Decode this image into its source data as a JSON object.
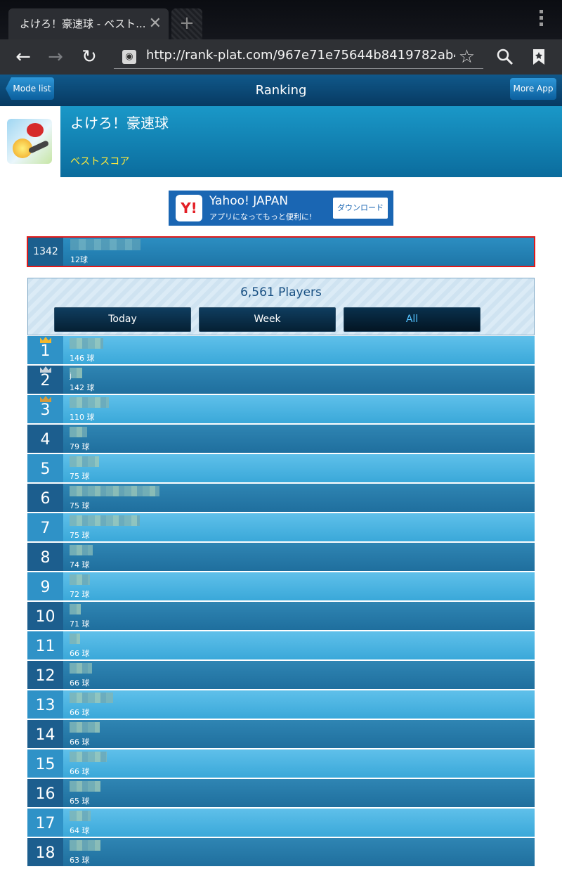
{
  "browser": {
    "tab_title": "よけろ！豪速球 - ベスト...",
    "tab_close": "✕",
    "new_tab": "+",
    "url": "http://rank-plat.com/967e71e75644b8419782ab4b36",
    "icons": [
      "back-icon",
      "forward-icon",
      "reload-icon",
      "globe-icon",
      "star-icon",
      "search-icon",
      "bookmarks-icon",
      "menu-icon"
    ]
  },
  "appbar": {
    "mode_list": "Mode list",
    "title": "Ranking",
    "more_app": "More App"
  },
  "game": {
    "title": "よけろ！豪速球",
    "subtitle": "ベストスコア"
  },
  "ad": {
    "logo": "Y!",
    "title": "Yahoo! JAPAN",
    "subtitle": "アプリになってもっと便利に!",
    "button": "ダウンロード"
  },
  "my_rank": {
    "rank": "1342",
    "score": "12球"
  },
  "filter": {
    "players": "6,561 Players",
    "today": "Today",
    "week": "Week",
    "all": "All",
    "selected": "All"
  },
  "colors": {
    "accent_active": "#55c3ff",
    "highlight_border": "#e01a1a",
    "crown_gold": "#f5b82a",
    "crown_silver": "#c9d2da",
    "crown_bronze": "#d69a3c"
  },
  "rankings": [
    {
      "rank": "1",
      "score": "146 球"
    },
    {
      "rank": "2",
      "score": "142 球",
      "name": "j"
    },
    {
      "rank": "3",
      "score": "110 球"
    },
    {
      "rank": "4",
      "score": "79 球"
    },
    {
      "rank": "5",
      "score": "75 球"
    },
    {
      "rank": "6",
      "score": "75 球"
    },
    {
      "rank": "7",
      "score": "75 球"
    },
    {
      "rank": "8",
      "score": "74 球"
    },
    {
      "rank": "9",
      "score": "72 球"
    },
    {
      "rank": "10",
      "score": "71 球"
    },
    {
      "rank": "11",
      "score": "66 球"
    },
    {
      "rank": "12",
      "score": "66 球"
    },
    {
      "rank": "13",
      "score": "66 球"
    },
    {
      "rank": "14",
      "score": "66 球"
    },
    {
      "rank": "15",
      "score": "66 球"
    },
    {
      "rank": "16",
      "score": "65 球"
    },
    {
      "rank": "17",
      "score": "64 球"
    },
    {
      "rank": "18",
      "score": "63 球"
    }
  ]
}
